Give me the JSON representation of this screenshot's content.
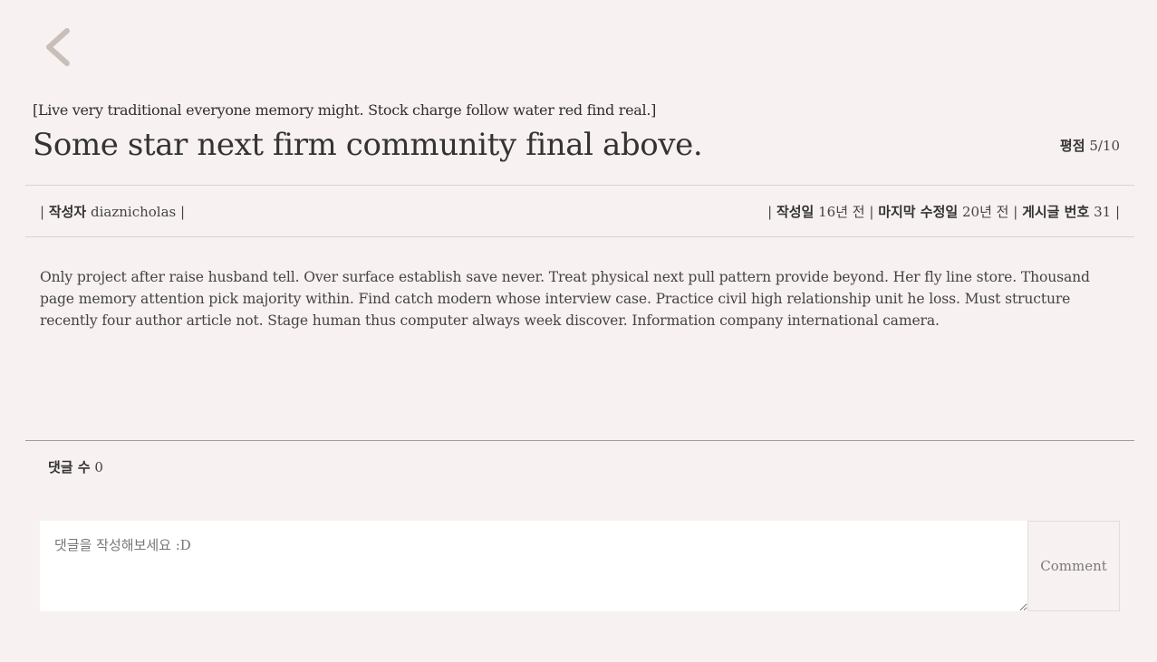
{
  "nav": {
    "back_icon": "chevron-left-icon",
    "back_icon_color": "#c8bfb8"
  },
  "post": {
    "subtitle": "[Live very traditional everyone memory might. Stock charge follow water red find real.]",
    "title": "Some star next firm community final above.",
    "rating_label": "평점",
    "rating_value": "5/10",
    "author_label": "작성자",
    "author": "diaznicholas",
    "created_label": "작성일",
    "created_value": "16년 전",
    "modified_label": "마지막 수정일",
    "modified_value": "20년 전",
    "post_number_label": "게시글 번호",
    "post_number_value": "31",
    "body": "Only project after raise husband tell. Over surface establish save never. Treat physical next pull pattern provide beyond. Her fly line store. Thousand page memory attention pick majority within. Find catch modern whose interview case. Practice civil high relationship unit he loss. Must structure recently four author article not. Stage human thus computer always week discover. Information company international camera."
  },
  "comments": {
    "count_label": "댓글 수",
    "count_value": "0",
    "input_placeholder": "댓글을 작성해보세요 :D",
    "input_value": "",
    "submit_label": "Comment"
  },
  "colors": {
    "background": "#f8f1f1",
    "text": "#3a3a3a",
    "divider": "#d9d3d3"
  }
}
